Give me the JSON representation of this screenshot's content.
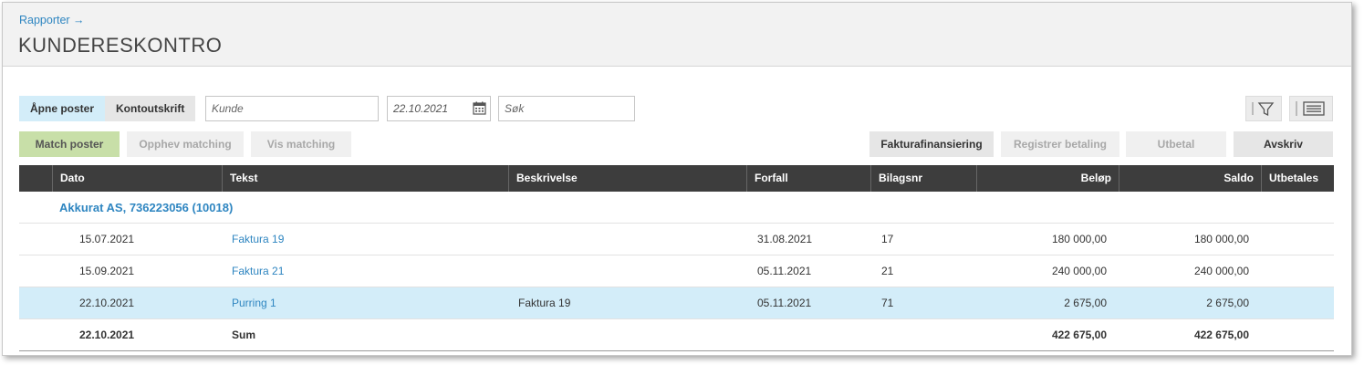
{
  "header": {
    "breadcrumb": "Rapporter →",
    "title": "KUNDERESKONTRO"
  },
  "toolbar": {
    "tab_open": "Åpne poster",
    "tab_statement": "Kontoutskrift",
    "customer_placeholder": "Kunde",
    "date_value": "22.10.2021",
    "search_placeholder": "Søk",
    "filter_icon": "filter-icon",
    "list_icon": "list-view-icon"
  },
  "actions": {
    "match": "Match poster",
    "unmatch": "Opphev matching",
    "show_matching": "Vis matching",
    "invoice_financing": "Fakturafinansiering",
    "register_payment": "Registrer betaling",
    "pay_out": "Utbetal",
    "write_off": "Avskriv"
  },
  "table": {
    "columns": {
      "date": "Dato",
      "text": "Tekst",
      "description": "Beskrivelse",
      "due": "Forfall",
      "voucher": "Bilagsnr",
      "amount": "Beløp",
      "balance": "Saldo",
      "payable": "Utbetales"
    },
    "group": "Akkurat AS, 736223056 (10018)",
    "rows": [
      {
        "date": "15.07.2021",
        "text": "Faktura 19",
        "description": "",
        "due": "31.08.2021",
        "voucher": "17",
        "amount": "180 000,00",
        "balance": "180 000,00"
      },
      {
        "date": "15.09.2021",
        "text": "Faktura 21",
        "description": "",
        "due": "05.11.2021",
        "voucher": "21",
        "amount": "240 000,00",
        "balance": "240 000,00"
      },
      {
        "date": "22.10.2021",
        "text": "Purring 1",
        "description": "Faktura 19",
        "due": "05.11.2021",
        "voucher": "71",
        "amount": "2 675,00",
        "balance": "2 675,00"
      }
    ],
    "sum": {
      "date": "22.10.2021",
      "label": "Sum",
      "amount": "422 675,00",
      "balance": "422 675,00"
    }
  }
}
